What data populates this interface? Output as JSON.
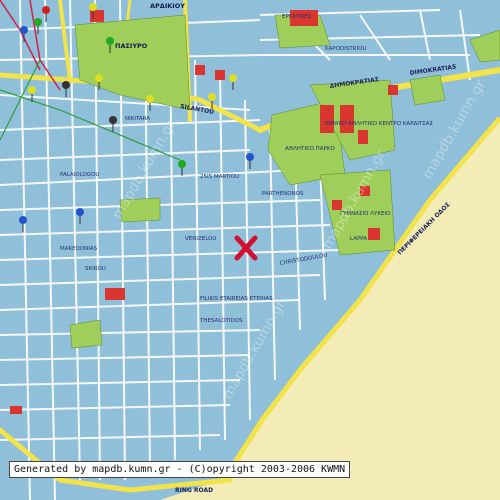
{
  "credit": "Generated by mapdb.kumn.gr - (C)opyright 2003-2006 KWMN",
  "watermark": "mapdb.kumn.gr",
  "colors": {
    "land": "#8fbfd9",
    "sea": "#f3ecb6",
    "road": "#f2e34b",
    "park": "#9fcf5a",
    "building": "#d8362e",
    "street": "#ffffff"
  },
  "labels": {
    "ardikiou": "ΑΡΔΙΚΙΟΥ",
    "pasiouro": "ΠΑΣΙΥΡΟ",
    "demokratias_gr": "ΔΗΜΟΚΡΑΤΙΑΣ",
    "demokratias": "DIMOKRATIAS",
    "ergatikes": "ΕΡΓΑΤΙΚΕΣ",
    "silantou": "SILANTOU",
    "kapodistriou": "KAPODISTRIOU",
    "athletic_park": "ΑΘΛΗΤΙΚΟ ΠΑΡΚΟ",
    "ethniko_athletiko": "ΕΘΝΙΚΟ ΑΘΛΗΤΙΚΟ ΚΕΝΤΡΟ ΚΑΡΔΙΤΣΑΣ",
    "nikitara": "NIKITARA",
    "martiou": "25IS MARTIOU",
    "palaiologou": "PALAIOLOGOU",
    "parthenonos": "PARTHENONOS",
    "gymnasio": "ΓΥΜΝΑΣΙΟ ΛΥΚΕΙΟ",
    "venizelou": "VENIZELOU",
    "makedonias": "MAKEDONIAS",
    "lappa": "LAPPA",
    "perifereiaki": "ΠΕΡΙΦΕΡΕΙΑΚΗ ΟΔΟΣ",
    "christodoulou": "CHRISTODOULOU",
    "filikis": "FILIKIS ETAIREIAS ETERIAS",
    "thessalotidos": "THESALOTIDOS",
    "skiroy": "SKIROU",
    "ring_road": "RING ROAD"
  }
}
